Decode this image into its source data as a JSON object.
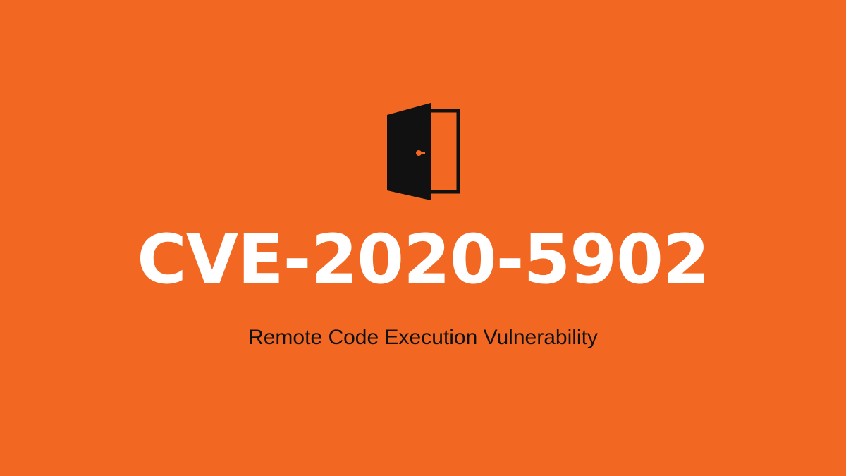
{
  "banner": {
    "icon": "open-door-icon",
    "title": "CVE-2020-5902",
    "subtitle": "Remote Code Execution Vulnerability"
  },
  "colors": {
    "background": "#F26822",
    "title_text": "#FFFFFF",
    "subtitle_text": "#111111",
    "icon": "#111111"
  }
}
